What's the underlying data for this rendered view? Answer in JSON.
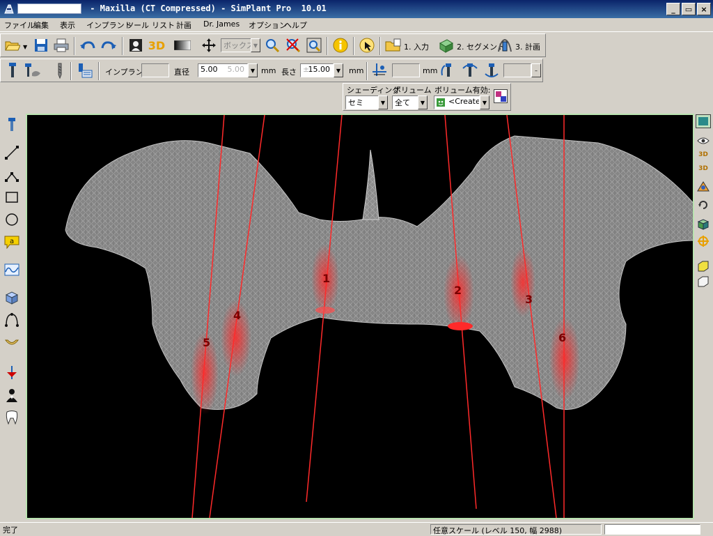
{
  "window": {
    "title": " - Maxilla (CT Compressed) - SimPlant Pro  10.01",
    "buttons": {
      "minimize": "_",
      "maximize": "▭",
      "close": "×"
    }
  },
  "menu": [
    "ファイル",
    "編集",
    "表示",
    "インプラント",
    "ツール",
    "リスト",
    "計画",
    "Dr. James",
    "オプション",
    "ヘルプ"
  ],
  "toolbar1": {
    "box_select": "ボックス",
    "workflow": [
      "1. 入力",
      "2. セグメント",
      "3. 計画"
    ]
  },
  "toolbar2": {
    "implant_label": "インプラント",
    "diameter_label": "直径",
    "diameter_value": "5.00",
    "diameter_secondary": "5.00",
    "diameter_unit": "mm",
    "length_label": "長さ",
    "length_prefix": "±",
    "length_value": "15.00",
    "length_unit": "mm",
    "offset_unit": "mm"
  },
  "shading_panel": {
    "shading_label": "シェーディング",
    "shading_value": "セミ",
    "volume_label": "ボリューム",
    "volume_value": "全て",
    "volume_enabled_label": "ボリューム有効:",
    "volume_enabled_value": "<Create"
  },
  "viewport": {
    "implant_labels": [
      "1",
      "2",
      "3",
      "4",
      "5",
      "6"
    ],
    "implant_color": "#ff2a2a",
    "bone_color": "#9a9a9a"
  },
  "status": {
    "left": "完了",
    "scale": "任意スケール (レベル 150, 幅 2988)"
  },
  "colors": {
    "titlebar": "#0a246a",
    "viewport_border": "#b9e3b0",
    "accent_yellow": "#e8c000"
  }
}
